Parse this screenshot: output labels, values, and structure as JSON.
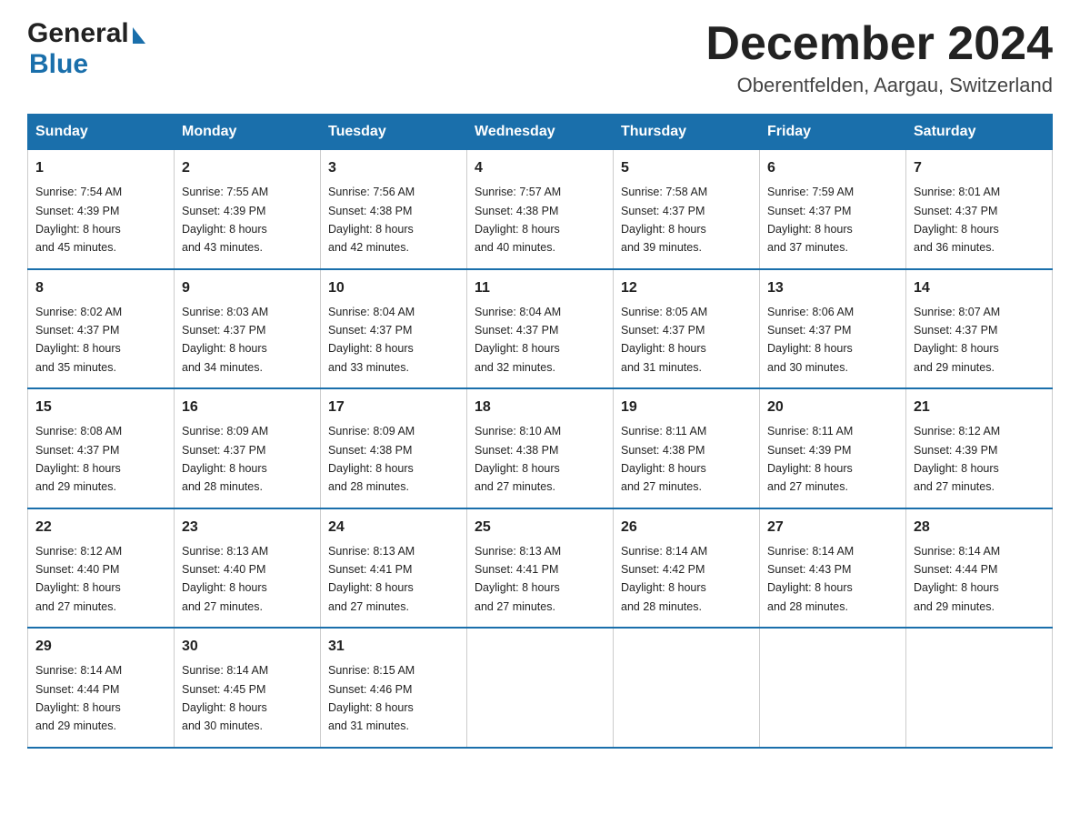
{
  "header": {
    "logo_general": "General",
    "logo_blue": "Blue",
    "month_title": "December 2024",
    "location": "Oberentfelden, Aargau, Switzerland"
  },
  "weekdays": [
    "Sunday",
    "Monday",
    "Tuesday",
    "Wednesday",
    "Thursday",
    "Friday",
    "Saturday"
  ],
  "weeks": [
    [
      {
        "day": "1",
        "sunrise": "7:54 AM",
        "sunset": "4:39 PM",
        "daylight": "8 hours and 45 minutes."
      },
      {
        "day": "2",
        "sunrise": "7:55 AM",
        "sunset": "4:39 PM",
        "daylight": "8 hours and 43 minutes."
      },
      {
        "day": "3",
        "sunrise": "7:56 AM",
        "sunset": "4:38 PM",
        "daylight": "8 hours and 42 minutes."
      },
      {
        "day": "4",
        "sunrise": "7:57 AM",
        "sunset": "4:38 PM",
        "daylight": "8 hours and 40 minutes."
      },
      {
        "day": "5",
        "sunrise": "7:58 AM",
        "sunset": "4:37 PM",
        "daylight": "8 hours and 39 minutes."
      },
      {
        "day": "6",
        "sunrise": "7:59 AM",
        "sunset": "4:37 PM",
        "daylight": "8 hours and 37 minutes."
      },
      {
        "day": "7",
        "sunrise": "8:01 AM",
        "sunset": "4:37 PM",
        "daylight": "8 hours and 36 minutes."
      }
    ],
    [
      {
        "day": "8",
        "sunrise": "8:02 AM",
        "sunset": "4:37 PM",
        "daylight": "8 hours and 35 minutes."
      },
      {
        "day": "9",
        "sunrise": "8:03 AM",
        "sunset": "4:37 PM",
        "daylight": "8 hours and 34 minutes."
      },
      {
        "day": "10",
        "sunrise": "8:04 AM",
        "sunset": "4:37 PM",
        "daylight": "8 hours and 33 minutes."
      },
      {
        "day": "11",
        "sunrise": "8:04 AM",
        "sunset": "4:37 PM",
        "daylight": "8 hours and 32 minutes."
      },
      {
        "day": "12",
        "sunrise": "8:05 AM",
        "sunset": "4:37 PM",
        "daylight": "8 hours and 31 minutes."
      },
      {
        "day": "13",
        "sunrise": "8:06 AM",
        "sunset": "4:37 PM",
        "daylight": "8 hours and 30 minutes."
      },
      {
        "day": "14",
        "sunrise": "8:07 AM",
        "sunset": "4:37 PM",
        "daylight": "8 hours and 29 minutes."
      }
    ],
    [
      {
        "day": "15",
        "sunrise": "8:08 AM",
        "sunset": "4:37 PM",
        "daylight": "8 hours and 29 minutes."
      },
      {
        "day": "16",
        "sunrise": "8:09 AM",
        "sunset": "4:37 PM",
        "daylight": "8 hours and 28 minutes."
      },
      {
        "day": "17",
        "sunrise": "8:09 AM",
        "sunset": "4:38 PM",
        "daylight": "8 hours and 28 minutes."
      },
      {
        "day": "18",
        "sunrise": "8:10 AM",
        "sunset": "4:38 PM",
        "daylight": "8 hours and 27 minutes."
      },
      {
        "day": "19",
        "sunrise": "8:11 AM",
        "sunset": "4:38 PM",
        "daylight": "8 hours and 27 minutes."
      },
      {
        "day": "20",
        "sunrise": "8:11 AM",
        "sunset": "4:39 PM",
        "daylight": "8 hours and 27 minutes."
      },
      {
        "day": "21",
        "sunrise": "8:12 AM",
        "sunset": "4:39 PM",
        "daylight": "8 hours and 27 minutes."
      }
    ],
    [
      {
        "day": "22",
        "sunrise": "8:12 AM",
        "sunset": "4:40 PM",
        "daylight": "8 hours and 27 minutes."
      },
      {
        "day": "23",
        "sunrise": "8:13 AM",
        "sunset": "4:40 PM",
        "daylight": "8 hours and 27 minutes."
      },
      {
        "day": "24",
        "sunrise": "8:13 AM",
        "sunset": "4:41 PM",
        "daylight": "8 hours and 27 minutes."
      },
      {
        "day": "25",
        "sunrise": "8:13 AM",
        "sunset": "4:41 PM",
        "daylight": "8 hours and 27 minutes."
      },
      {
        "day": "26",
        "sunrise": "8:14 AM",
        "sunset": "4:42 PM",
        "daylight": "8 hours and 28 minutes."
      },
      {
        "day": "27",
        "sunrise": "8:14 AM",
        "sunset": "4:43 PM",
        "daylight": "8 hours and 28 minutes."
      },
      {
        "day": "28",
        "sunrise": "8:14 AM",
        "sunset": "4:44 PM",
        "daylight": "8 hours and 29 minutes."
      }
    ],
    [
      {
        "day": "29",
        "sunrise": "8:14 AM",
        "sunset": "4:44 PM",
        "daylight": "8 hours and 29 minutes."
      },
      {
        "day": "30",
        "sunrise": "8:14 AM",
        "sunset": "4:45 PM",
        "daylight": "8 hours and 30 minutes."
      },
      {
        "day": "31",
        "sunrise": "8:15 AM",
        "sunset": "4:46 PM",
        "daylight": "8 hours and 31 minutes."
      },
      null,
      null,
      null,
      null
    ]
  ],
  "labels": {
    "sunrise": "Sunrise:",
    "sunset": "Sunset:",
    "daylight": "Daylight:"
  }
}
